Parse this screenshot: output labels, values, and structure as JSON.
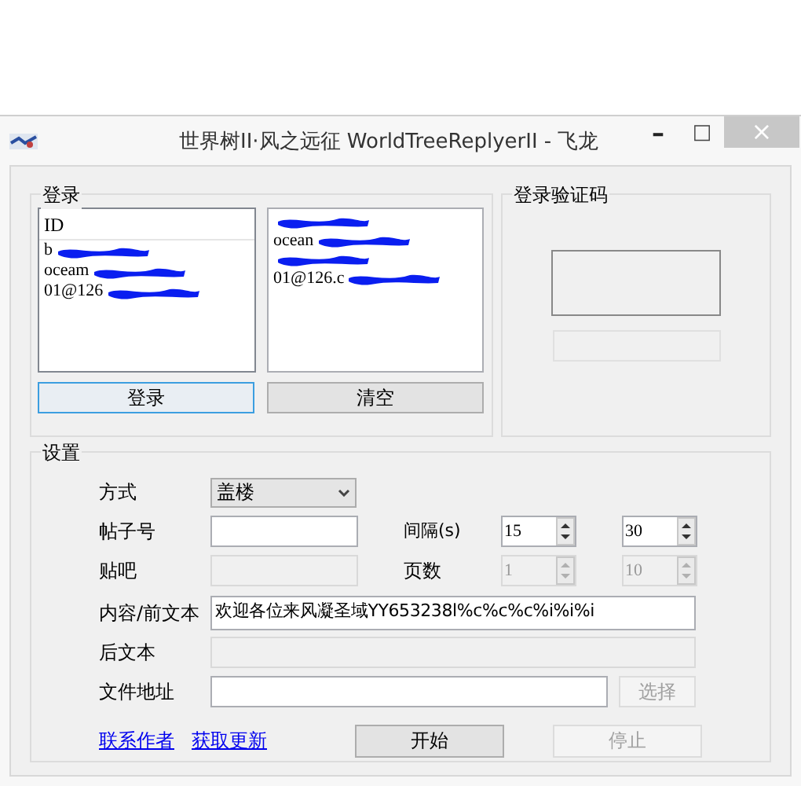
{
  "window": {
    "title": "世界树II·风之远征 WorldTreeReplyerII - 飞龙",
    "controls": [
      {
        "kind": "minimize",
        "label": "–"
      },
      {
        "kind": "maximize",
        "label": "□"
      },
      {
        "kind": "close",
        "label": "×"
      }
    ]
  },
  "login_group": {
    "title": "登录",
    "accounts_list": {
      "header": "ID",
      "items": [
        {
          "text": "b",
          "redacted": true
        },
        {
          "text": "oceam",
          "redacted": true
        },
        {
          "text": "01@126",
          "redacted": true
        }
      ]
    },
    "added_list": {
      "items": [
        {
          "redacted": true
        },
        {
          "text": "ocean",
          "redacted": true
        },
        {
          "redacted": true
        },
        {
          "text": "01@126.c",
          "redacted": true
        }
      ]
    },
    "buttons": [
      {
        "label": "登录",
        "focused": true
      },
      {
        "label": "清空",
        "focused": false
      }
    ]
  },
  "captcha_group": {
    "title": "登录验证码",
    "code_field": {
      "disabled": true
    }
  },
  "settings": {
    "title": "设置",
    "mode": {
      "label": "方式",
      "value": "盖楼"
    },
    "post_id": {
      "label": "帖子号",
      "disabled": false
    },
    "interval": {
      "label": "间隔(s)",
      "spinners": [
        {
          "value": "15",
          "disabled": false
        },
        {
          "value": "30",
          "disabled": false
        }
      ]
    },
    "forum": {
      "label": "贴吧",
      "disabled": true
    },
    "pages": {
      "label": "页数",
      "spinners": [
        {
          "value": "1",
          "disabled": true
        },
        {
          "value": "10",
          "disabled": true
        }
      ]
    },
    "content": {
      "label": "内容/前文本",
      "value": "欢迎各位来风凝圣域YY653238l%c%c%c%i%i%i",
      "disabled": false
    },
    "suffix": {
      "label": "后文本",
      "disabled": true
    },
    "file": {
      "label": "文件地址",
      "disabled": false,
      "button": {
        "label": "选择",
        "disabled": true
      }
    },
    "links": [
      "联系作者",
      "获取更新"
    ],
    "buttons": [
      {
        "label": "开始",
        "disabled": false
      },
      {
        "label": "停止",
        "disabled": true
      }
    ]
  }
}
